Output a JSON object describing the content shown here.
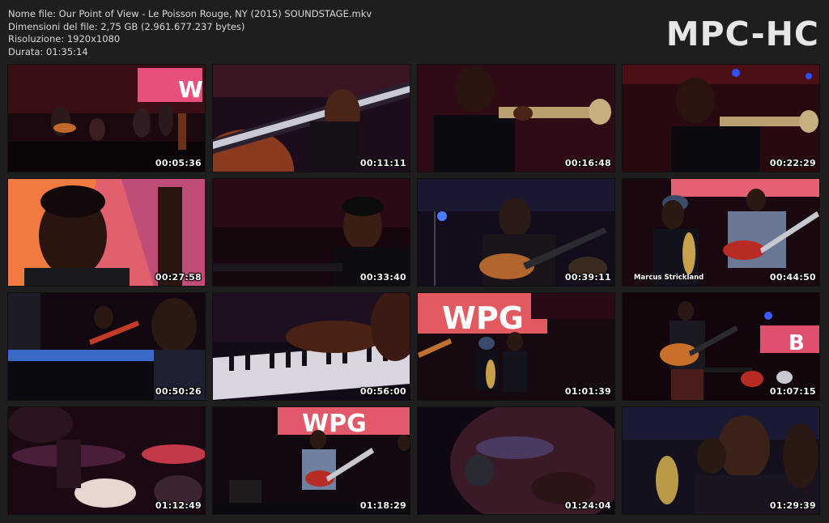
{
  "file_info": {
    "name_line": "Nome file: Our Point of View - Le Poisson Rouge, NY (2015) SOUNDSTAGE.mkv",
    "size_line": "Dimensioni del file: 2,75 GB (2.961.677.237 bytes)",
    "resolution_line": "Risoluzione: 1920x1080",
    "duration_line": "Durata: 01:35:14"
  },
  "brand": {
    "logo_text": "MPC-HC"
  },
  "thumbnails": [
    {
      "timestamp": "00:05:36",
      "scene": "band-wide-stage"
    },
    {
      "timestamp": "00:11:11",
      "scene": "guitar-neck-closeup"
    },
    {
      "timestamp": "00:16:48",
      "scene": "trumpet-player"
    },
    {
      "timestamp": "00:22:29",
      "scene": "trumpet-player"
    },
    {
      "timestamp": "00:27:58",
      "scene": "face-closeup-orange"
    },
    {
      "timestamp": "00:33:40",
      "scene": "keyboard-player-dark"
    },
    {
      "timestamp": "00:39:11",
      "scene": "guitarist-blue"
    },
    {
      "timestamp": "00:44:50",
      "scene": "sax-and-guitar",
      "caption": "Marcus Strickland"
    },
    {
      "timestamp": "00:50:26",
      "scene": "piano-and-guitar"
    },
    {
      "timestamp": "00:56:00",
      "scene": "piano-keys-hand"
    },
    {
      "timestamp": "01:01:39",
      "scene": "band-wpg-banner"
    },
    {
      "timestamp": "01:07:15",
      "scene": "guitarist-stage-wide"
    },
    {
      "timestamp": "01:12:49",
      "scene": "drummer-closeup"
    },
    {
      "timestamp": "01:18:29",
      "scene": "band-wpg-banner-2"
    },
    {
      "timestamp": "01:24:04",
      "scene": "face-mic-closeup"
    },
    {
      "timestamp": "01:29:39",
      "scene": "sax-player-closeup"
    }
  ]
}
